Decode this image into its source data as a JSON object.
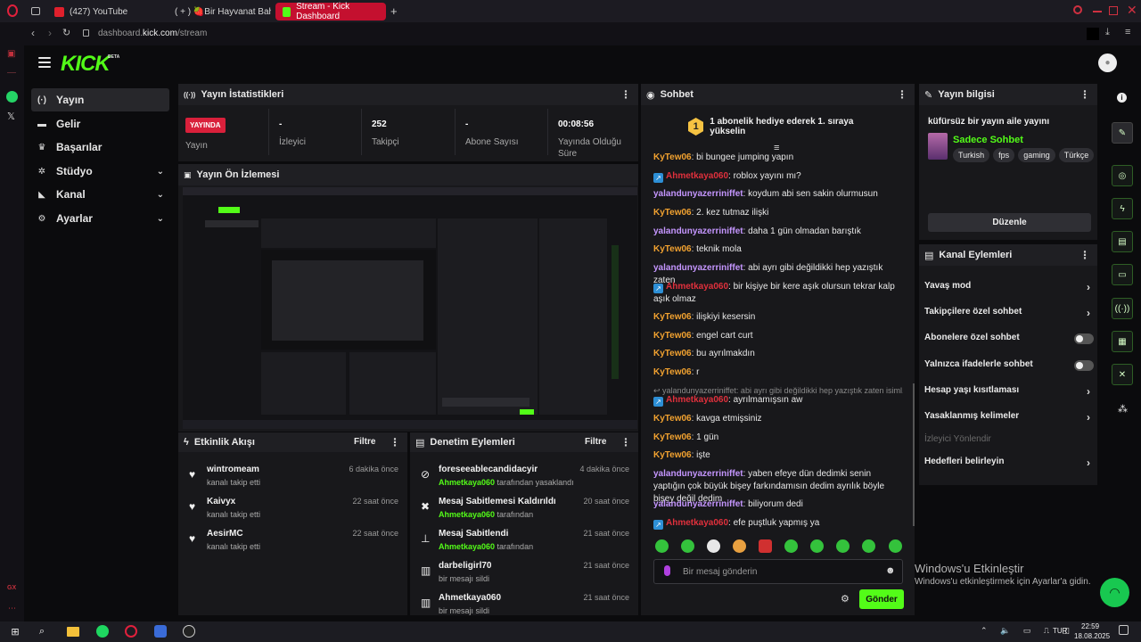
{
  "browser": {
    "tabs": [
      {
        "label": "(427) YouTube"
      },
      {
        "label": "( + ) 🍓Bir Hayvanat Bah"
      },
      {
        "label": "Stream - Kick Dashboard"
      }
    ],
    "url_prefix": "dashboard.",
    "url_host": "kick.com",
    "url_path": "/stream"
  },
  "header": {
    "logo": "KICK",
    "beta": "BETA"
  },
  "sidebar": {
    "items": [
      {
        "label": "Yayın"
      },
      {
        "label": "Gelir"
      },
      {
        "label": "Başarılar"
      },
      {
        "label": "Stüdyo"
      },
      {
        "label": "Kanal"
      },
      {
        "label": "Ayarlar"
      }
    ]
  },
  "stats": {
    "title": "Yayın İstatistikleri",
    "live_badge": "YAYINDA",
    "live_label": "Yayın",
    "viewers_value": "-",
    "viewers_label": "İzleyici",
    "followers_value": "252",
    "followers_label": "Takipçi",
    "subs_value": "-",
    "subs_label": "Abone Sayısı",
    "duration_value": "00:08:56",
    "duration_label": "Yayında Olduğu Süre"
  },
  "preview": {
    "title": "Yayın Ön İzlemesi"
  },
  "activity": {
    "title": "Etkinlik Akışı",
    "filter": "Filtre",
    "items": [
      {
        "name": "wintromeam",
        "desc": "kanalı takip etti",
        "time": "6 dakika önce"
      },
      {
        "name": "Kaivyx",
        "desc": "kanalı takip etti",
        "time": "22 saat önce"
      },
      {
        "name": "AesirMC",
        "desc": "kanalı takip etti",
        "time": "22 saat önce"
      }
    ]
  },
  "moderation": {
    "title": "Denetim Eylemleri",
    "filter": "Filtre",
    "items": [
      {
        "title": "foreseeablecandidacyir",
        "actor": "Ahmetkaya060",
        "suffix": " tarafından yasaklandı",
        "time": "4 dakika önce"
      },
      {
        "title": "Mesaj Sabitlemesi Kaldırıldı",
        "actor": "Ahmetkaya060",
        "suffix": " tarafından",
        "time": "20 saat önce"
      },
      {
        "title": "Mesaj Sabitlendi",
        "actor": "Ahmetkaya060",
        "suffix": " tarafından",
        "time": "21 saat önce"
      },
      {
        "title": "darbeligirl70",
        "actor": "",
        "suffix": "bir mesajı sildi",
        "time": "21 saat önce"
      },
      {
        "title": "Ahmetkaya060",
        "actor": "",
        "suffix": "bir mesajı sildi",
        "time": "21 saat önce"
      }
    ]
  },
  "chat": {
    "title": "Sohbet",
    "gift_rank": "1",
    "gift_text": "1 abonelik hediye ederek 1. sıraya yükselin",
    "messages": [
      {
        "user": "KyTew06",
        "text": ": bi bungee jumping yapın"
      },
      {
        "user": "Ahmetkaya060",
        "text": ": roblox yayını mı?"
      },
      {
        "user": "yalandunyazerriniffet",
        "text": ": koydum abi sen sakin olurmusun"
      },
      {
        "user": "KyTew06",
        "text": ": 2. kez tutmaz ilişki"
      },
      {
        "user": "yalandunyazerriniffet",
        "text": ": daha 1 gün olmadan barıştık"
      },
      {
        "user": "KyTew06",
        "text": ": teknik mola"
      },
      {
        "user": "yalandunyazerriniffet",
        "text": ": abi ayrı gibi değildikki hep yazıştık zaten"
      },
      {
        "user": "Ahmetkaya060",
        "text": ": bir kişiye bir kere aşık olursun tekrar kalp aşık olmaz"
      },
      {
        "user": "KyTew06",
        "text": ": ilişkiyi kesersin"
      },
      {
        "user": "KyTew06",
        "text": ": engel cart curt"
      },
      {
        "user": "KyTew06",
        "text": ": bu ayrılmakdın"
      },
      {
        "user": "KyTew06",
        "text": ": r"
      },
      {
        "user": "Ahmetkaya060",
        "text": ": ayrılmamışsın aw"
      },
      {
        "user": "KyTew06",
        "text": ": kavga etmişsiniz"
      },
      {
        "user": "KyTew06",
        "text": ": 1 gün"
      },
      {
        "user": "KyTew06",
        "text": ": işte"
      },
      {
        "user": "yalandunyazerriniffet",
        "text": ": yaben efeye dün dedimki senin yaptığın çok büyük bişey farkındamısın dedim ayrılık böyle bişey değil dedim"
      },
      {
        "user": "yalandunyazerriniffet",
        "text": ": biliyorum dedi"
      },
      {
        "user": "Ahmetkaya060",
        "text": ": efe puştluk yapmış ya"
      }
    ],
    "reply_preview": "yalandunyazerriniffet: abi ayrı gibi değildikki hep yazıştık zaten isiml...",
    "input_placeholder": "Bir mesaj gönderin",
    "send_label": "Gönder"
  },
  "stream_info": {
    "title": "Yayın bilgisi",
    "stream_title": "küfürsüz bir yayın aile yayını",
    "category": "Sadece Sohbet",
    "tags": [
      "Turkish",
      "fps",
      "gaming",
      "Türkçe"
    ],
    "edit_label": "Düzenle"
  },
  "channel_actions": {
    "title": "Kanal Eylemleri",
    "slow_mode": "Yavaş mod",
    "followers_only": "Takipçilere özel sohbet",
    "subs_only": "Abonelere özel sohbet",
    "emotes_only": "Yalnızca ifadelerle sohbet",
    "account_age": "Hesap yaşı kısıtlaması",
    "banned_words": "Yasaklanmış kelimeler",
    "redirect": "İzleyici Yönlendir",
    "goals": "Hedefleri belirleyin"
  },
  "windows": {
    "activate_title": "Windows'u Etkinleştir",
    "activate_sub": "Windows'u etkinleştirmek için Ayarlar'a gidin.",
    "lang": "TUR",
    "time": "22:59",
    "date": "18.08.2025"
  },
  "colors": {
    "brand": "#53fc18",
    "live": "#d9203b",
    "tab_active": "#c4102f"
  }
}
